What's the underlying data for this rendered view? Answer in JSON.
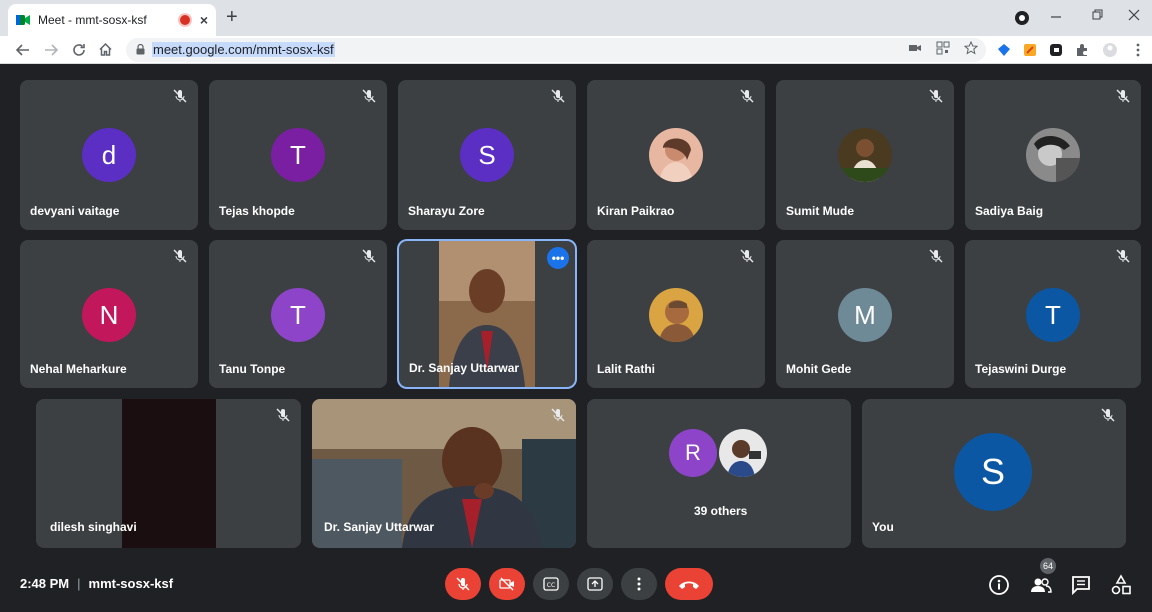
{
  "browser": {
    "tab_title": "Meet - mmt-sosx-ksf",
    "tab_close": "×",
    "new_tab": "+",
    "url": "meet.google.com/mmt-sosx-ksf"
  },
  "tiles": [
    {
      "name": "devyani vaitage",
      "initial": "d",
      "color": "#5b2fc4"
    },
    {
      "name": "Tejas khopde",
      "initial": "T",
      "color": "#7b1fa2"
    },
    {
      "name": "Sharayu Zore",
      "initial": "S",
      "color": "#5b2fc4"
    },
    {
      "name": "Kiran Paikrao"
    },
    {
      "name": "Sumit Mude"
    },
    {
      "name": "Sadiya Baig"
    },
    {
      "name": "Nehal Meharkure",
      "initial": "N",
      "color": "#c2185b"
    },
    {
      "name": "Tanu Tonpe",
      "initial": "T",
      "color": "#8e44c9"
    },
    {
      "name": "Dr. Sanjay Uttarwar"
    },
    {
      "name": "Lalit Rathi"
    },
    {
      "name": "Mohit Gede",
      "initial": "M",
      "color": "#6e8a97"
    },
    {
      "name": "Tejaswini Durge",
      "initial": "T",
      "color": "#0b57a4"
    },
    {
      "name": "dilesh singhavi"
    },
    {
      "name": "Dr. Sanjay Uttarwar"
    },
    {
      "name": "R",
      "others": "39 others"
    },
    {
      "name": "You",
      "initial": "S",
      "color": "#0b57a4"
    }
  ],
  "selected_more": "•••",
  "others_initial": "R",
  "others_label": "39 others",
  "you_initial": "S",
  "bottom": {
    "time": "2:48 PM",
    "separator": "|",
    "meeting_code": "mmt-sosx-ksf",
    "people_count": "64"
  }
}
